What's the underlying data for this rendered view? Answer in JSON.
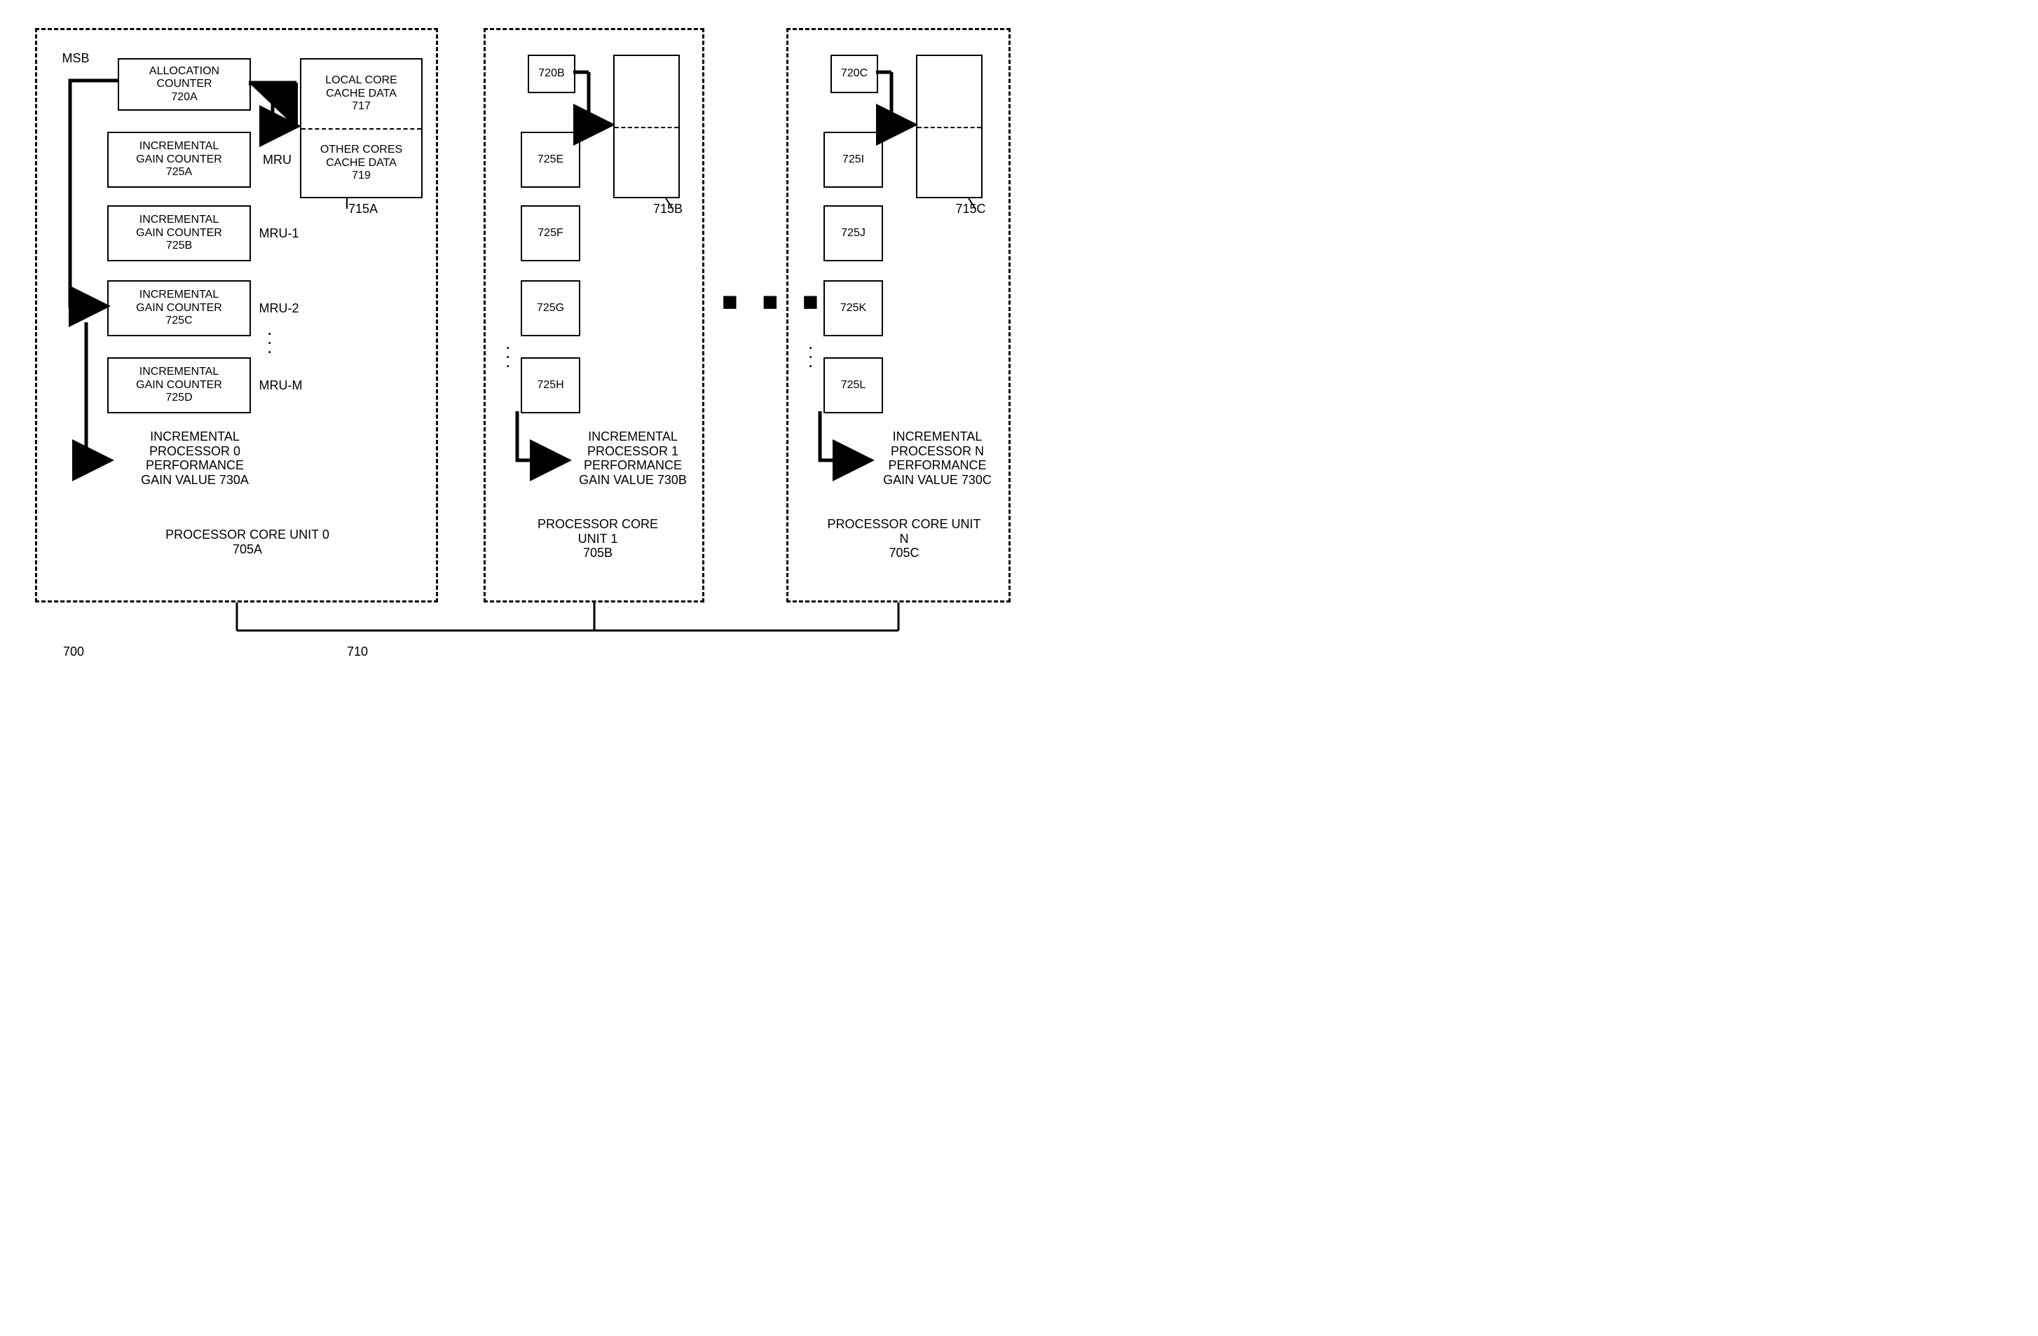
{
  "figure": {
    "number": "700",
    "bus_label": "710"
  },
  "msb_label": "MSB",
  "unit0": {
    "title_line1": "PROCESSOR CORE UNIT 0",
    "title_line2": "705A",
    "alloc": {
      "l1": "ALLOCATION",
      "l2": "COUNTER",
      "ref": "720A"
    },
    "gainA": {
      "l1": "INCREMENTAL",
      "l2": "GAIN COUNTER",
      "ref": "725A",
      "mru": "MRU"
    },
    "gainB": {
      "l1": "INCREMENTAL",
      "l2": "GAIN COUNTER",
      "ref": "725B",
      "mru": "MRU-1"
    },
    "gainC": {
      "l1": "INCREMENTAL",
      "l2": "GAIN COUNTER",
      "ref": "725C",
      "mru": "MRU-2"
    },
    "gainD": {
      "l1": "INCREMENTAL",
      "l2": "GAIN COUNTER",
      "ref": "725D",
      "mru": "MRU-M"
    },
    "cache_local": {
      "l1": "LOCAL CORE",
      "l2": "CACHE DATA",
      "ref": "717"
    },
    "cache_other": {
      "l1": "OTHER CORES",
      "l2": "CACHE DATA",
      "ref": "719"
    },
    "cache_ref": "715A",
    "gain_value": {
      "l1": "INCREMENTAL",
      "l2": "PROCESSOR 0",
      "l3": "PERFORMANCE",
      "l4": "GAIN VALUE 730A"
    }
  },
  "unit1": {
    "title_line1": "PROCESSOR CORE",
    "title_line2": "UNIT 1",
    "title_line3": "705B",
    "alloc_ref": "720B",
    "g1": "725E",
    "g2": "725F",
    "g3": "725G",
    "g4": "725H",
    "cache_ref": "715B",
    "gain_value": {
      "l1": "INCREMENTAL",
      "l2": "PROCESSOR 1",
      "l3": "PERFORMANCE",
      "l4": "GAIN VALUE 730B"
    }
  },
  "unitN": {
    "title_line1": "PROCESSOR CORE UNIT",
    "title_line2": "N",
    "title_line3": "705C",
    "alloc_ref": "720C",
    "g1": "725I",
    "g2": "725J",
    "g3": "725K",
    "g4": "725L",
    "cache_ref": "715C",
    "gain_value": {
      "l1": "INCREMENTAL",
      "l2": "PROCESSOR N",
      "l3": "PERFORMANCE",
      "l4": "GAIN VALUE 730C"
    }
  }
}
